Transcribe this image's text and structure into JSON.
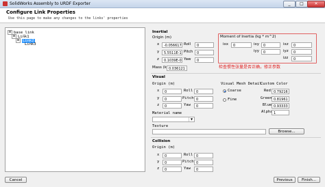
{
  "window": {
    "title": "SolidWorks Assembly to URDF Exporter",
    "minimize": "_",
    "maximize": "□",
    "close": "✕"
  },
  "header": {
    "title": "Configure Link Properties",
    "subtitle": "Use this page to make any changes to the links' properties"
  },
  "tree": {
    "items": [
      {
        "label": "base_link",
        "toggle": "⊟"
      },
      {
        "label": "Link1",
        "toggle": "⊟"
      },
      {
        "label": "Link2",
        "toggle": "⊟"
      },
      {
        "label": "Link3",
        "toggle": ""
      }
    ]
  },
  "inertial": {
    "section": "Inertial",
    "origin_label": "Origin (m)",
    "x_label": "x",
    "y_label": "y",
    "z_label": "z",
    "x": "-0.056617",
    "y": "5.5511E-17",
    "z": "0.1039E-05",
    "roll_label": "Roll",
    "pitch_label": "Pitch",
    "yaw_label": "Yaw",
    "roll": "0",
    "pitch": "0",
    "yaw": "0",
    "mass_label": "Mass (kg)",
    "mass": "0.036121",
    "moi_label": "Moment of Inertia (kg * m^2)",
    "ixx_label": "ixx",
    "ixy_label": "ixy",
    "ixz_label": "ixz",
    "iyy_label": "iyy",
    "iyz_label": "iyz",
    "izz_label": "izz",
    "ixx": "0",
    "ixy": "0",
    "ixz": "0",
    "iyy": "0",
    "iyz": "0",
    "izz": "0",
    "annotation": "检查惯性张量是否正确，修正参数"
  },
  "visual": {
    "section": "Visual",
    "origin_label": "Origin (m)",
    "x": "0",
    "y": "0",
    "z": "0",
    "roll": "0",
    "pitch": "0",
    "yaw": "0",
    "mesh_detail_label": "Visual Mesh Detail",
    "coarse_label": "Coarse",
    "fine_label": "Fine",
    "custom_color_label": "Custom Color",
    "red_label": "Red",
    "green_label": "Green",
    "blue_label": "Blue",
    "alpha_label": "Alpha",
    "red": "0.79216",
    "green": "0.81961",
    "blue": "0.93333",
    "alpha": "1",
    "material_label": "Material name",
    "texture_label": "Texture",
    "browse_label": "Browse..."
  },
  "collision": {
    "section": "Collision",
    "origin_label": "Origin (m)",
    "x": "0",
    "y": "0",
    "z": "0",
    "roll": "0",
    "pitch": "0",
    "yaw": "0"
  },
  "footer": {
    "cancel": "Cancel",
    "previous": "Previous",
    "finish": "Finish..."
  }
}
